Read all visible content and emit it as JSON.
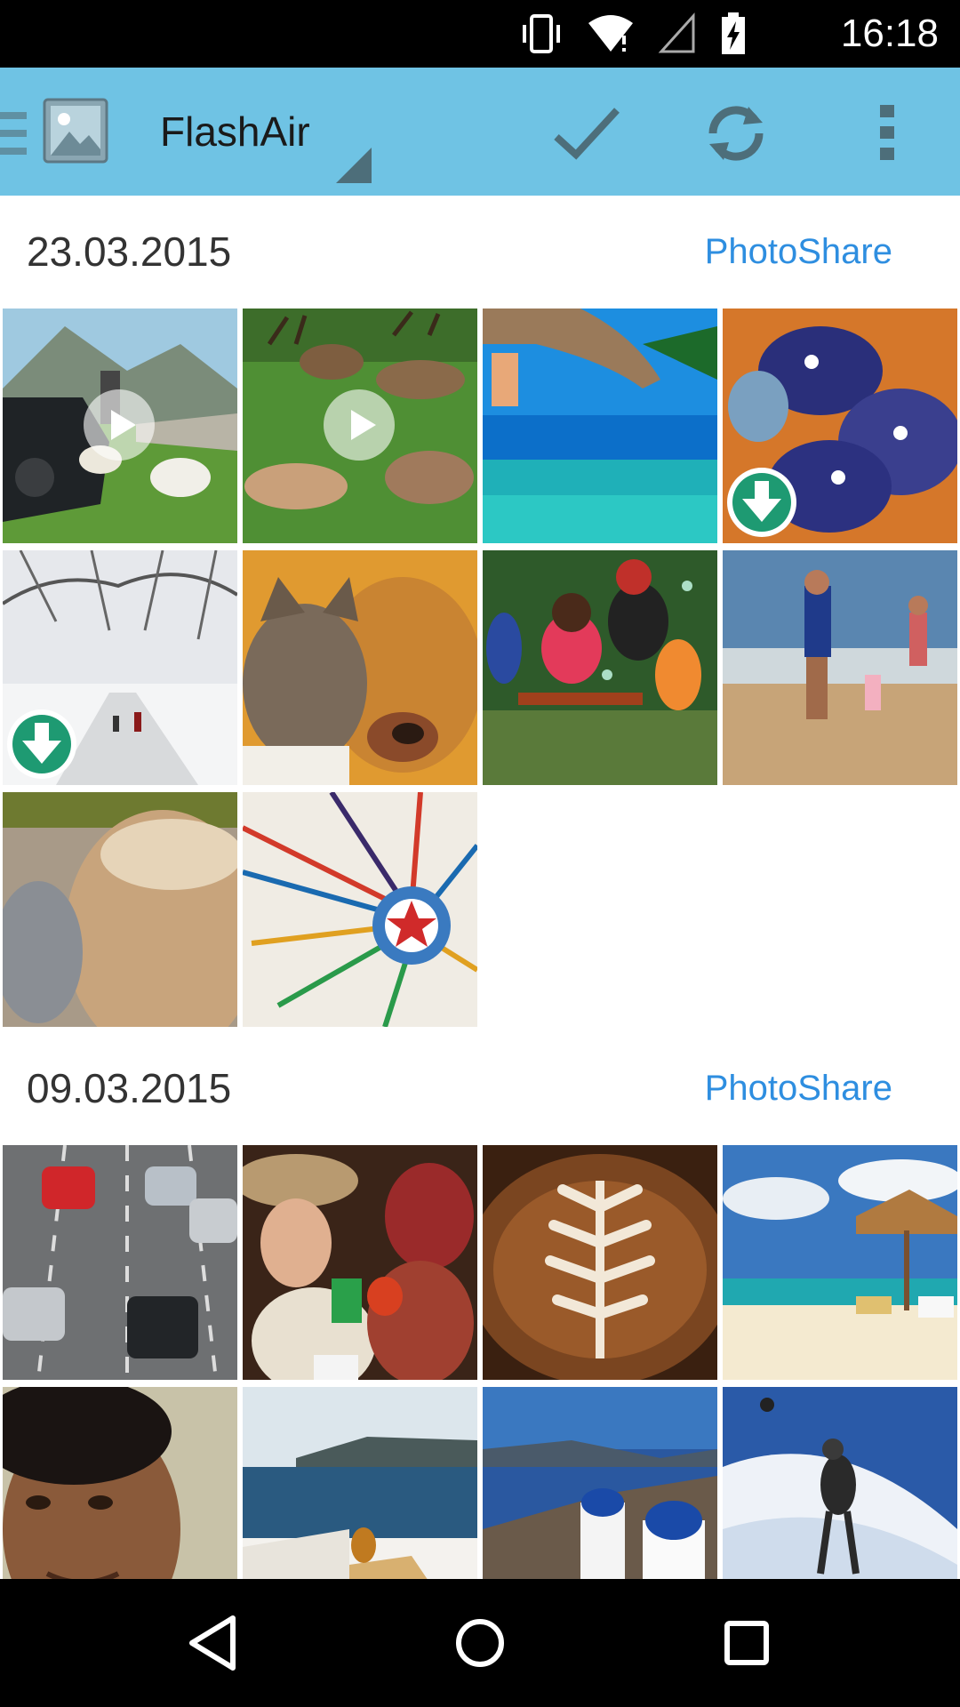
{
  "status_bar": {
    "time": "16:18",
    "icons": [
      "vibrate-icon",
      "wifi-icon",
      "cell-signal-icon",
      "battery-charging-icon"
    ]
  },
  "app_bar": {
    "title": "FlashAir",
    "logo_icon": "gallery-icon",
    "actions": [
      "select-check-icon",
      "refresh-icon",
      "overflow-menu-icon"
    ],
    "background": "#6fc3e4"
  },
  "sections": [
    {
      "date": "23.03.2015",
      "share_label": "PhotoShare",
      "tiles": [
        {
          "subject": "car-goats-road",
          "badge": "play"
        },
        {
          "subject": "deer-meadow",
          "badge": "play"
        },
        {
          "subject": "palm-sea",
          "badge": ""
        },
        {
          "subject": "elephant-toys",
          "badge": "download"
        },
        {
          "subject": "snowy-park",
          "badge": "download"
        },
        {
          "subject": "cat-dog",
          "badge": ""
        },
        {
          "subject": "family-bubbles",
          "badge": ""
        },
        {
          "subject": "beach-family",
          "badge": ""
        },
        {
          "subject": "latte-glass",
          "badge": ""
        },
        {
          "subject": "beaded-ornament",
          "badge": ""
        }
      ]
    },
    {
      "date": "09.03.2015",
      "share_label": "PhotoShare",
      "tiles": [
        {
          "subject": "highway-cars",
          "badge": ""
        },
        {
          "subject": "women-party",
          "badge": ""
        },
        {
          "subject": "latte-art",
          "badge": ""
        },
        {
          "subject": "beach-umbrella",
          "badge": ""
        },
        {
          "subject": "boy-portrait",
          "badge": ""
        },
        {
          "subject": "santorini-terrace",
          "badge": ""
        },
        {
          "subject": "santorini-church",
          "badge": ""
        },
        {
          "subject": "skier-snow",
          "badge": ""
        }
      ]
    }
  ],
  "nav_bar": {
    "buttons": [
      "back-icon",
      "home-icon",
      "recents-icon"
    ]
  },
  "colors": {
    "accent_link": "#2e8ee0",
    "download_badge": "#1e9a72"
  }
}
